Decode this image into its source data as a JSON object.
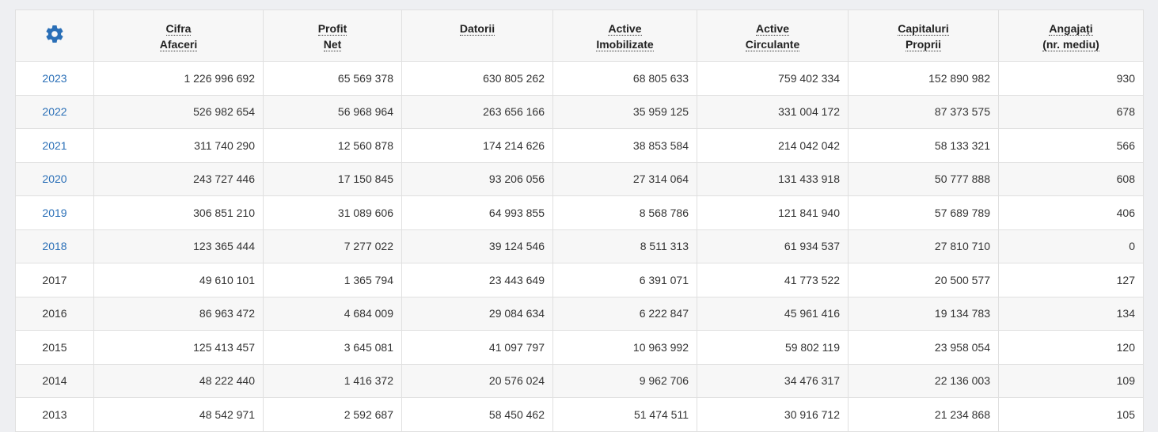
{
  "settings_icon": "gear-icon",
  "colors": {
    "accent": "#2a6fb7",
    "header_bg": "#f7f7f7",
    "stripe_bg": "#f7f7f7",
    "border": "#e0e0e0"
  },
  "columns": [
    {
      "line1": "Cifra",
      "line2": "Afaceri"
    },
    {
      "line1": "Profit",
      "line2": "Net"
    },
    {
      "line1": "Datorii",
      "line2": ""
    },
    {
      "line1": "Active",
      "line2": "Imobilizate"
    },
    {
      "line1": "Active",
      "line2": "Circulante"
    },
    {
      "line1": "Capitaluri",
      "line2": "Proprii"
    },
    {
      "line1": "Angajați",
      "line2": "(nr. mediu)"
    }
  ],
  "rows": [
    {
      "year": "2023",
      "link": true,
      "values": [
        "1 226 996 692",
        "65 569 378",
        "630 805 262",
        "68 805 633",
        "759 402 334",
        "152 890 982",
        "930"
      ]
    },
    {
      "year": "2022",
      "link": true,
      "values": [
        "526 982 654",
        "56 968 964",
        "263 656 166",
        "35 959 125",
        "331 004 172",
        "87 373 575",
        "678"
      ]
    },
    {
      "year": "2021",
      "link": true,
      "values": [
        "311 740 290",
        "12 560 878",
        "174 214 626",
        "38 853 584",
        "214 042 042",
        "58 133 321",
        "566"
      ]
    },
    {
      "year": "2020",
      "link": true,
      "values": [
        "243 727 446",
        "17 150 845",
        "93 206 056",
        "27 314 064",
        "131 433 918",
        "50 777 888",
        "608"
      ]
    },
    {
      "year": "2019",
      "link": true,
      "values": [
        "306 851 210",
        "31 089 606",
        "64 993 855",
        "8 568 786",
        "121 841 940",
        "57 689 789",
        "406"
      ]
    },
    {
      "year": "2018",
      "link": true,
      "values": [
        "123 365 444",
        "7 277 022",
        "39 124 546",
        "8 511 313",
        "61 934 537",
        "27 810 710",
        "0"
      ]
    },
    {
      "year": "2017",
      "link": false,
      "values": [
        "49 610 101",
        "1 365 794",
        "23 443 649",
        "6 391 071",
        "41 773 522",
        "20 500 577",
        "127"
      ]
    },
    {
      "year": "2016",
      "link": false,
      "values": [
        "86 963 472",
        "4 684 009",
        "29 084 634",
        "6 222 847",
        "45 961 416",
        "19 134 783",
        "134"
      ]
    },
    {
      "year": "2015",
      "link": false,
      "values": [
        "125 413 457",
        "3 645 081",
        "41 097 797",
        "10 963 992",
        "59 802 119",
        "23 958 054",
        "120"
      ]
    },
    {
      "year": "2014",
      "link": false,
      "values": [
        "48 222 440",
        "1 416 372",
        "20 576 024",
        "9 962 706",
        "34 476 317",
        "22 136 003",
        "109"
      ]
    },
    {
      "year": "2013",
      "link": false,
      "values": [
        "48 542 971",
        "2 592 687",
        "58 450 462",
        "51 474 511",
        "30 916 712",
        "21 234 868",
        "105"
      ]
    }
  ]
}
